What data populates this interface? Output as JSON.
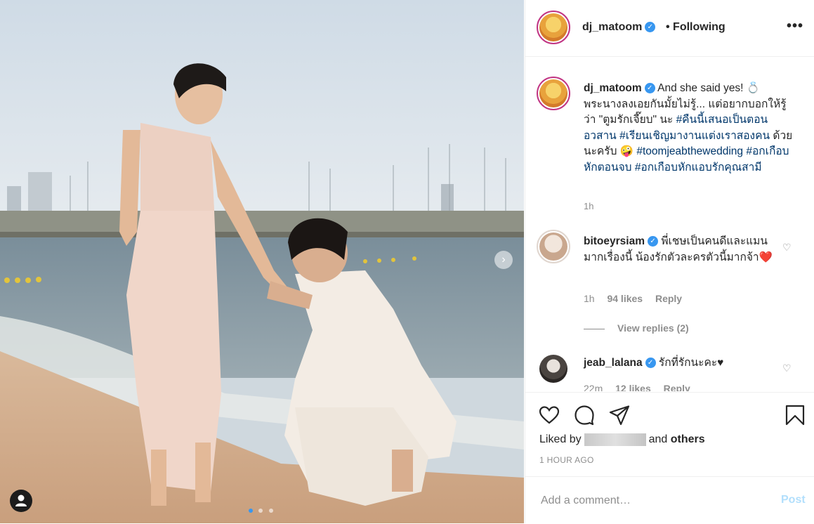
{
  "post": {
    "author": "dj_matoom",
    "follow_status": "• Following",
    "more_icon": "more-horizontal-icon"
  },
  "caption": {
    "author": "dj_matoom",
    "line_intro": "And she said yes! 💍",
    "line_thai": "พระนางลงเอยกันมั้ยไม่รู้... แต่อยากบอกให้รู้ว่า \"ตูมรักเจี๊ยบ\" นะ",
    "tag1": "#คืนนี้เสนอเป็นตอนอวสาน",
    "tag2": "#เรียนเชิญมางานแต่งเราสองคน",
    "after_tag2": "ด้วยนะครับ 🤪",
    "tag3": "#toomjeabthewedding",
    "tag4": "#อกเกือบหักตอนจบ",
    "tag5": "#อกเกือบหักแอบรักคุณสามี",
    "time": "1h"
  },
  "comments": [
    {
      "author": "bitoeyrsiam",
      "text": "พี่เชษเป็นคนดีและแมนมากเรื่องนี้ น้องรักตัวละครตัวนี้มากจ้า❤️",
      "time": "1h",
      "likes": "94 likes",
      "reply": "Reply",
      "view_replies": "View replies (2)"
    },
    {
      "author": "jeab_lalana",
      "text": "รักที่รักนะคะ♥",
      "time": "22m",
      "likes": "12 likes",
      "reply": "Reply"
    }
  ],
  "actions": {
    "liked_prefix": "Liked by",
    "liked_suffix": "and",
    "others": "others",
    "timestamp": "1 HOUR AGO"
  },
  "add_comment": {
    "placeholder": "Add a comment…",
    "post_label": "Post"
  },
  "colors": {
    "verified": "#3897f0",
    "hashtag": "#00376b",
    "muted": "#8e8e8e",
    "post_disabled": "#b2dffc",
    "heart_emoji": "#e0245e"
  }
}
